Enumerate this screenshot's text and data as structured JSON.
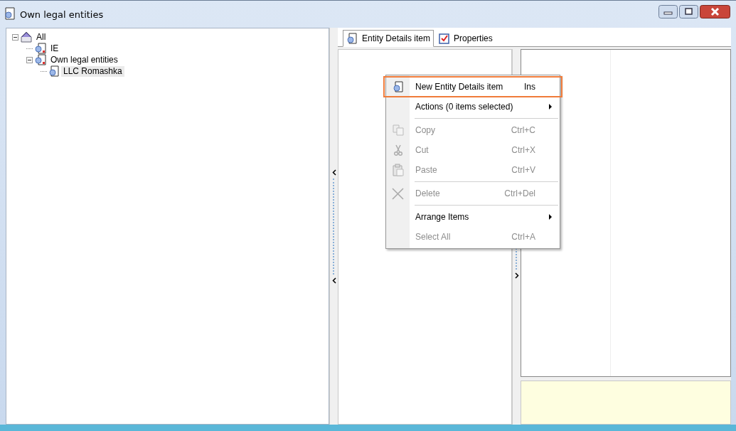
{
  "window": {
    "title": "Own legal entities"
  },
  "tree": [
    {
      "label": "All",
      "kind": "root",
      "expanded": true,
      "selected": false,
      "children": [
        {
          "label": "IE",
          "kind": "group",
          "selected": false
        },
        {
          "label": "Own legal entities",
          "kind": "group",
          "expanded": true,
          "selected": false,
          "children": [
            {
              "label": "LLC Romashka",
              "kind": "entity",
              "selected": true
            }
          ]
        }
      ]
    }
  ],
  "tabs": [
    {
      "label": "Entity Details item",
      "kind": "entity",
      "selected": true
    },
    {
      "label": "Properties",
      "kind": "properties",
      "selected": false
    }
  ],
  "context_menu": [
    {
      "kind": "new",
      "label": "New Entity Details item",
      "shortcut": "Ins",
      "disabled": false,
      "selected": true
    },
    {
      "kind": "command",
      "label": "Actions (0 items selected)",
      "submenu": true,
      "disabled": false,
      "selected": false
    },
    {
      "kind": "separator"
    },
    {
      "kind": "copy",
      "label": "Copy",
      "shortcut": "Ctrl+C",
      "disabled": true,
      "selected": false
    },
    {
      "kind": "cut",
      "label": "Cut",
      "shortcut": "Ctrl+X",
      "disabled": true,
      "selected": false
    },
    {
      "kind": "paste",
      "label": "Paste",
      "shortcut": "Ctrl+V",
      "disabled": true,
      "selected": false
    },
    {
      "kind": "separator"
    },
    {
      "kind": "delete",
      "label": "Delete",
      "shortcut": "Ctrl+Del",
      "disabled": true,
      "selected": false
    },
    {
      "kind": "separator"
    },
    {
      "kind": "command",
      "label": "Arrange Items",
      "submenu": true,
      "disabled": false,
      "selected": false
    },
    {
      "kind": "command",
      "label": "Select All",
      "shortcut": "Ctrl+A",
      "disabled": true,
      "selected": false
    }
  ]
}
